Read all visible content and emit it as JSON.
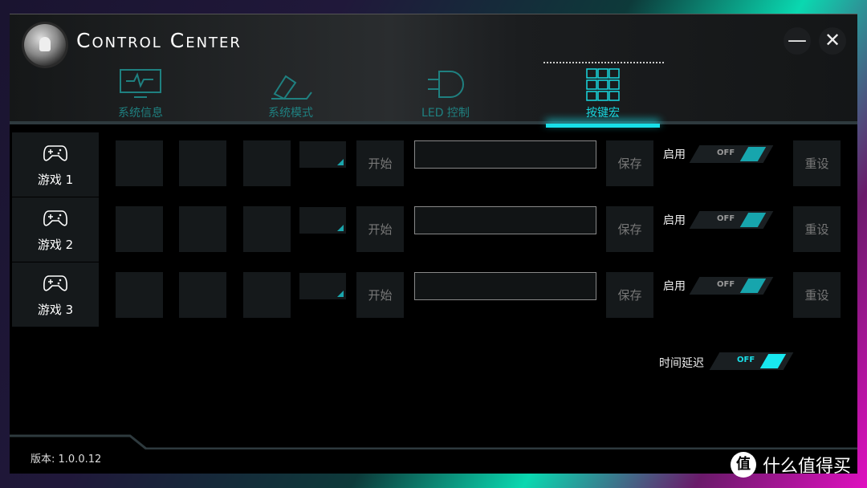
{
  "window": {
    "title": "Control Center",
    "minimize_icon": "minus-icon",
    "close_icon": "x-icon"
  },
  "tabs": [
    {
      "label": "系统信息",
      "icon": "monitor-pulse-icon",
      "active": false
    },
    {
      "label": "系统模式",
      "icon": "plug-icon",
      "active": false
    },
    {
      "label": "LED 控制",
      "icon": "led-icon",
      "active": false
    },
    {
      "label": "按键宏",
      "icon": "keypad-icon",
      "active": true
    }
  ],
  "games": [
    {
      "label": "游戏 1",
      "icon": "gamepad-icon",
      "start": "开始",
      "save": "保存",
      "enable_label": "启用",
      "toggle": "OFF",
      "reset": "重设",
      "input": ""
    },
    {
      "label": "游戏 2",
      "icon": "gamepad-icon",
      "start": "开始",
      "save": "保存",
      "enable_label": "启用",
      "toggle": "OFF",
      "reset": "重设",
      "input": ""
    },
    {
      "label": "游戏 3",
      "icon": "gamepad-icon",
      "start": "开始",
      "save": "保存",
      "enable_label": "启用",
      "toggle": "OFF",
      "reset": "重设",
      "input": ""
    }
  ],
  "delay": {
    "label": "时间延迟",
    "toggle": "OFF"
  },
  "footer": {
    "version": "版本: 1.0.0.12"
  },
  "watermark": {
    "logo": "值",
    "text": "什么值得买"
  },
  "colors": {
    "accent": "#18dfe8",
    "inactive_tab": "#1f8080",
    "panel": "#15191b"
  }
}
